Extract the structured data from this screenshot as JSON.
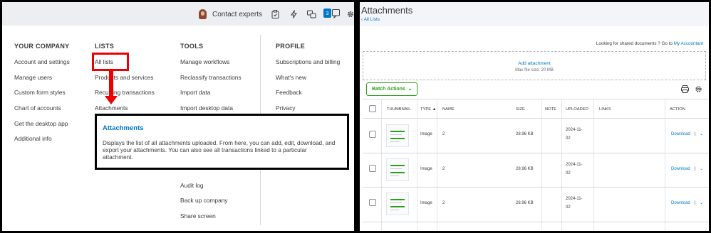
{
  "left": {
    "topbar": {
      "contact_label": "Contact experts",
      "badge": "3"
    },
    "columns": {
      "company": {
        "header": "YOUR COMPANY",
        "items": [
          "Account and settings",
          "Manage users",
          "Custom form styles",
          "Chart of accounts",
          "Get the desktop app",
          "Additional info"
        ]
      },
      "lists": {
        "header": "LISTS",
        "items": [
          "All lists",
          "Products and services",
          "Recurring transactions",
          "Attachments"
        ]
      },
      "tools": {
        "header": "TOOLS",
        "items": [
          "Manage workflows",
          "Reclassify transactions",
          "Import data",
          "Import desktop data",
          "Audit log",
          "Back up company",
          "Share screen"
        ]
      },
      "profile": {
        "header": "PROFILE",
        "items": [
          "Subscriptions and billing",
          "What's new",
          "Feedback",
          "Privacy"
        ]
      }
    },
    "tooltip": {
      "title": "Attachments",
      "body": "Displays the list of all attachments uploaded. From here, you can add, edit, download, and export your attachments. You can also see all transactions linked to a particular attachment."
    }
  },
  "right": {
    "title": "Attachments",
    "back_link": "‹ All Lists",
    "shared_prefix": "Looking for shared documents ? Go to ",
    "shared_link": "My Accountant",
    "add_attachment": "Add attachment",
    "max_size": "Max file size: 20 MB",
    "batch_actions": "Batch Actions",
    "table": {
      "headers": [
        "THUMBNAIL",
        "TYPE ▲",
        "NAME",
        "SIZE",
        "NOTE",
        "UPLOADED",
        "LINKS",
        "ACTION"
      ],
      "rows": [
        {
          "type": "Image",
          "name": "2",
          "size": "28.96 KB",
          "uploaded_1": "2024-11-",
          "uploaded_2": "02",
          "action": "Download",
          "sep": "|"
        },
        {
          "type": "Image",
          "name": "2",
          "size": "28.96 KB",
          "uploaded_1": "2024-11-",
          "uploaded_2": "02",
          "action": "Download",
          "sep": "|"
        },
        {
          "type": "Image",
          "name": "2",
          "size": "28.96 KB",
          "uploaded_1": "2024-11-",
          "uploaded_2": "02",
          "action": "Download",
          "sep": "|"
        }
      ]
    }
  },
  "colors": {
    "link": "#0077c5",
    "green": "#2ca01c",
    "annotation_red": "#e00000"
  }
}
